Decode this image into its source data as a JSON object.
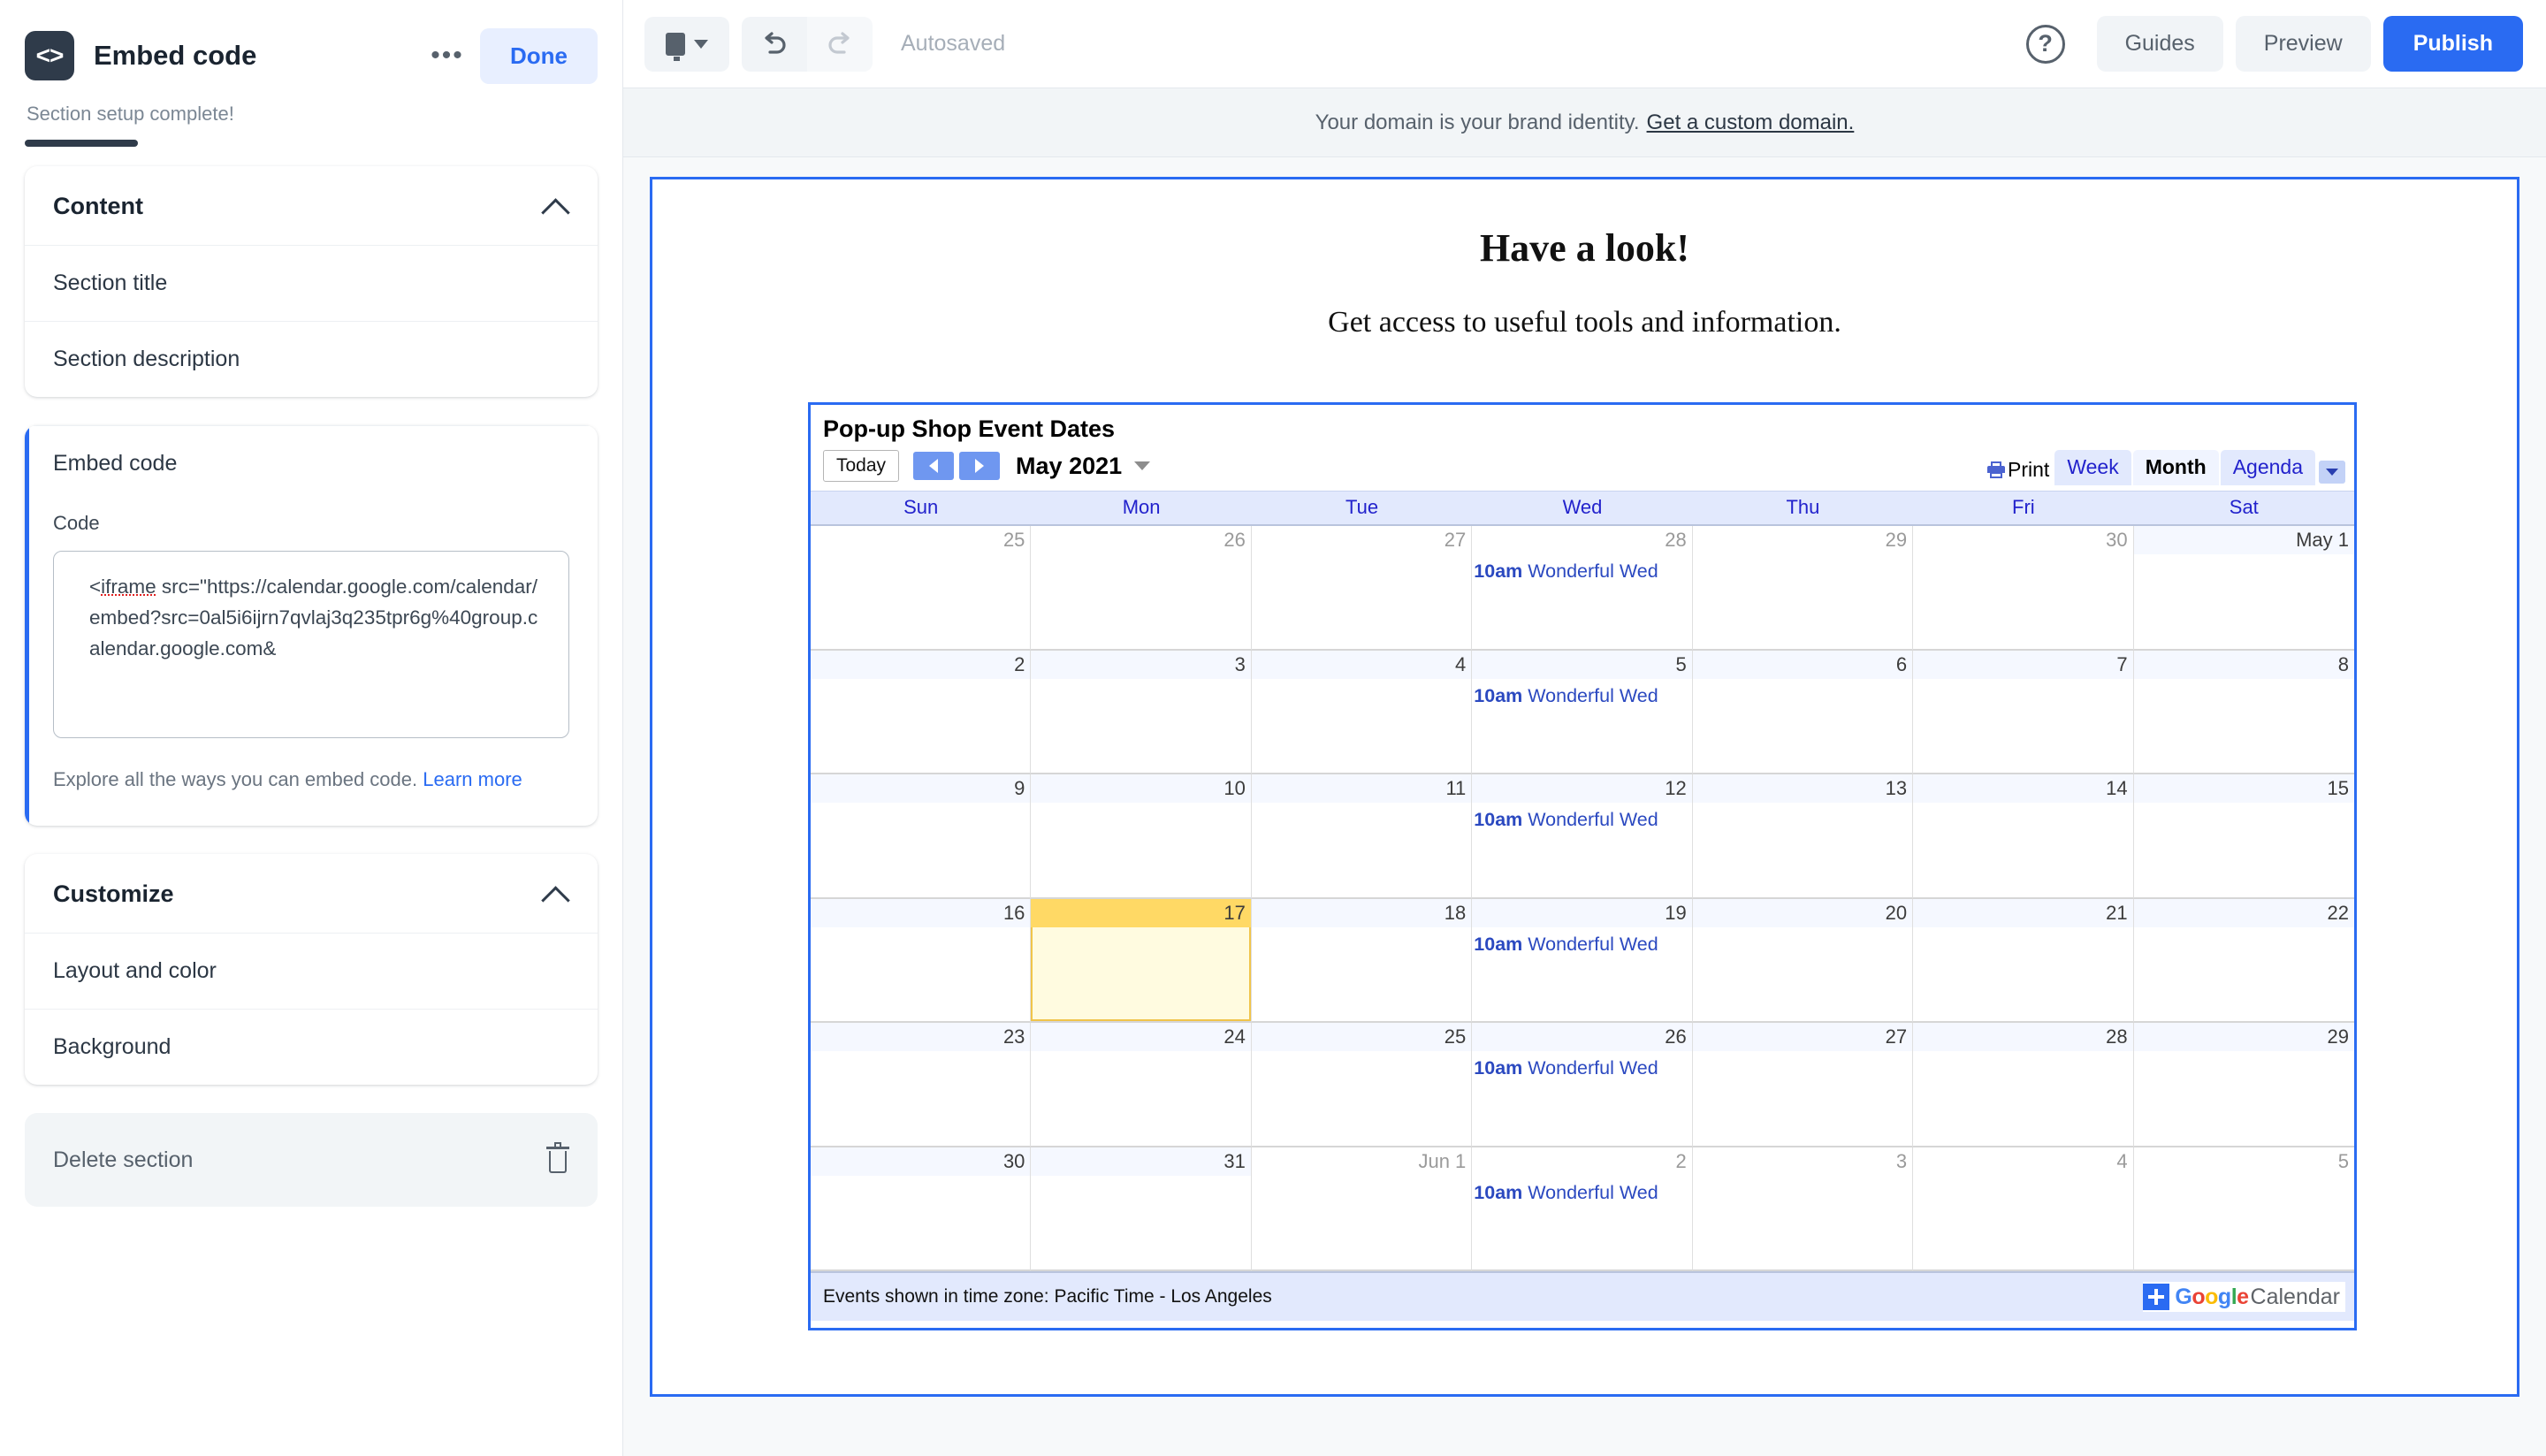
{
  "left_panel": {
    "icon": "code-icon",
    "title": "Embed code",
    "more_label": "•••",
    "done_label": "Done",
    "setup_note": "Section setup complete!",
    "content_card": {
      "heading": "Content",
      "collapse_icon": "chevron-up-icon",
      "rows": [
        {
          "label": "Section title"
        },
        {
          "label": "Section description"
        }
      ]
    },
    "embed_card": {
      "title": "Embed code",
      "code_label": "Code",
      "code_value_prefix": "<",
      "code_value_tag": "iframe",
      "code_value_rest": " src=\"https://calendar.google.com/calendar/embed?src=0al5i6ijrn7qvlaj3q235tpr6g%40group.calendar.google.com&",
      "help_text": "Explore all the ways you can embed code. ",
      "help_link": "Learn more"
    },
    "customize_card": {
      "heading": "Customize",
      "collapse_icon": "chevron-up-icon",
      "rows": [
        {
          "label": "Layout and color"
        },
        {
          "label": "Background"
        }
      ]
    },
    "delete_card": {
      "label": "Delete section",
      "icon": "trash-icon"
    }
  },
  "toolbar": {
    "device_icon": "monitor-icon",
    "device_caret": "chevron-down-icon",
    "undo_icon": "undo-arrow-icon",
    "redo_icon": "redo-arrow-icon",
    "autosave_status": "Autosaved",
    "help_icon": "question-circle-icon",
    "help_glyph": "?",
    "guides_label": "Guides",
    "preview_label": "Preview",
    "publish_label": "Publish",
    "accent_color": "#2a6bf2"
  },
  "domain_banner": {
    "text": "Your domain is your brand identity.",
    "link": "Get a custom domain."
  },
  "canvas": {
    "heading": "Have a look!",
    "subheading": "Get access to useful tools and information."
  },
  "calendar": {
    "title": "Pop-up Shop Event Dates",
    "today_label": "Today",
    "prev_icon": "chevron-left-icon",
    "next_icon": "chevron-right-icon",
    "month_label": "May 2021",
    "month_caret": "chevron-down-icon",
    "print_label": "Print",
    "print_icon": "printer-icon",
    "views": [
      {
        "label": "Week",
        "active": false
      },
      {
        "label": "Month",
        "active": true
      },
      {
        "label": "Agenda",
        "active": false
      }
    ],
    "view_dropdown_icon": "chevron-down-icon",
    "day_names": [
      "Sun",
      "Mon",
      "Tue",
      "Wed",
      "Thu",
      "Fri",
      "Sat"
    ],
    "event_time": "10am",
    "event_title": " Wonderful Wed",
    "weeks": [
      [
        {
          "date": "25",
          "other": true,
          "shade": false,
          "today": false,
          "event": false
        },
        {
          "date": "26",
          "other": true,
          "shade": false,
          "today": false,
          "event": false
        },
        {
          "date": "27",
          "other": true,
          "shade": false,
          "today": false,
          "event": false
        },
        {
          "date": "28",
          "other": true,
          "shade": false,
          "today": false,
          "event": true
        },
        {
          "date": "29",
          "other": true,
          "shade": false,
          "today": false,
          "event": false
        },
        {
          "date": "30",
          "other": true,
          "shade": false,
          "today": false,
          "event": false
        },
        {
          "date": "May 1",
          "other": false,
          "shade": true,
          "today": false,
          "event": false
        }
      ],
      [
        {
          "date": "2",
          "other": false,
          "shade": true,
          "today": false,
          "event": false
        },
        {
          "date": "3",
          "other": false,
          "shade": true,
          "today": false,
          "event": false
        },
        {
          "date": "4",
          "other": false,
          "shade": true,
          "today": false,
          "event": false
        },
        {
          "date": "5",
          "other": false,
          "shade": true,
          "today": false,
          "event": true
        },
        {
          "date": "6",
          "other": false,
          "shade": true,
          "today": false,
          "event": false
        },
        {
          "date": "7",
          "other": false,
          "shade": true,
          "today": false,
          "event": false
        },
        {
          "date": "8",
          "other": false,
          "shade": true,
          "today": false,
          "event": false
        }
      ],
      [
        {
          "date": "9",
          "other": false,
          "shade": true,
          "today": false,
          "event": false
        },
        {
          "date": "10",
          "other": false,
          "shade": true,
          "today": false,
          "event": false
        },
        {
          "date": "11",
          "other": false,
          "shade": true,
          "today": false,
          "event": false
        },
        {
          "date": "12",
          "other": false,
          "shade": true,
          "today": false,
          "event": true
        },
        {
          "date": "13",
          "other": false,
          "shade": true,
          "today": false,
          "event": false
        },
        {
          "date": "14",
          "other": false,
          "shade": true,
          "today": false,
          "event": false
        },
        {
          "date": "15",
          "other": false,
          "shade": true,
          "today": false,
          "event": false
        }
      ],
      [
        {
          "date": "16",
          "other": false,
          "shade": true,
          "today": false,
          "event": false
        },
        {
          "date": "17",
          "other": false,
          "shade": false,
          "today": true,
          "event": false
        },
        {
          "date": "18",
          "other": false,
          "shade": true,
          "today": false,
          "event": false
        },
        {
          "date": "19",
          "other": false,
          "shade": true,
          "today": false,
          "event": true
        },
        {
          "date": "20",
          "other": false,
          "shade": true,
          "today": false,
          "event": false
        },
        {
          "date": "21",
          "other": false,
          "shade": true,
          "today": false,
          "event": false
        },
        {
          "date": "22",
          "other": false,
          "shade": true,
          "today": false,
          "event": false
        }
      ],
      [
        {
          "date": "23",
          "other": false,
          "shade": true,
          "today": false,
          "event": false
        },
        {
          "date": "24",
          "other": false,
          "shade": true,
          "today": false,
          "event": false
        },
        {
          "date": "25",
          "other": false,
          "shade": true,
          "today": false,
          "event": false
        },
        {
          "date": "26",
          "other": false,
          "shade": true,
          "today": false,
          "event": true
        },
        {
          "date": "27",
          "other": false,
          "shade": true,
          "today": false,
          "event": false
        },
        {
          "date": "28",
          "other": false,
          "shade": true,
          "today": false,
          "event": false
        },
        {
          "date": "29",
          "other": false,
          "shade": true,
          "today": false,
          "event": false
        }
      ],
      [
        {
          "date": "30",
          "other": false,
          "shade": true,
          "today": false,
          "event": false
        },
        {
          "date": "31",
          "other": false,
          "shade": true,
          "today": false,
          "event": false
        },
        {
          "date": "Jun 1",
          "other": true,
          "shade": false,
          "today": false,
          "event": false
        },
        {
          "date": "2",
          "other": true,
          "shade": false,
          "today": false,
          "event": true
        },
        {
          "date": "3",
          "other": true,
          "shade": false,
          "today": false,
          "event": false
        },
        {
          "date": "4",
          "other": true,
          "shade": false,
          "today": false,
          "event": false
        },
        {
          "date": "5",
          "other": true,
          "shade": false,
          "today": false,
          "event": false
        }
      ]
    ],
    "timezone_note": "Events shown in time zone: Pacific Time - Los Angeles",
    "logo": {
      "plus_icon": "plus-icon",
      "g1": "G",
      "o1": "o",
      "o2": "o",
      "g2": "g",
      "l": "l",
      "e": "e",
      "calendar_word": "Calendar"
    }
  }
}
